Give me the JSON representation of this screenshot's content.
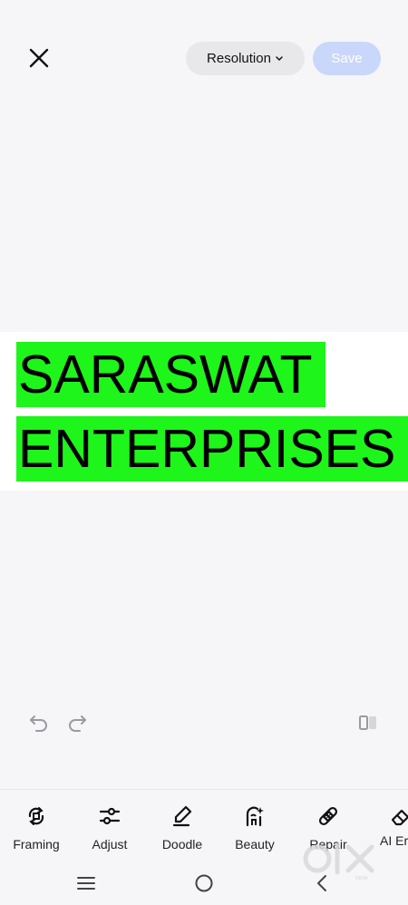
{
  "header": {
    "close_icon": "close-icon",
    "resolution_label": "Resolution",
    "save_label": "Save"
  },
  "image": {
    "line1": "SARASWAT",
    "line2": "ENTERPRISES",
    "highlight_color": "#1ef51a"
  },
  "history": {
    "undo_icon": "undo-icon",
    "redo_icon": "redo-icon",
    "compare_icon": "compare-icon"
  },
  "tools": [
    {
      "label": "Framing",
      "icon": "framing-icon"
    },
    {
      "label": "Adjust",
      "icon": "adjust-icon"
    },
    {
      "label": "Doodle",
      "icon": "doodle-icon"
    },
    {
      "label": "Beauty",
      "icon": "beauty-icon"
    },
    {
      "label": "Repair",
      "icon": "repair-icon"
    },
    {
      "label": "AI Eras",
      "icon": "eraser-icon"
    }
  ],
  "watermark": {
    "text": "OLX",
    "sub": "INDIA"
  },
  "nav": {
    "menu_icon": "menu-icon",
    "home_icon": "home-icon",
    "back_icon": "back-icon"
  }
}
